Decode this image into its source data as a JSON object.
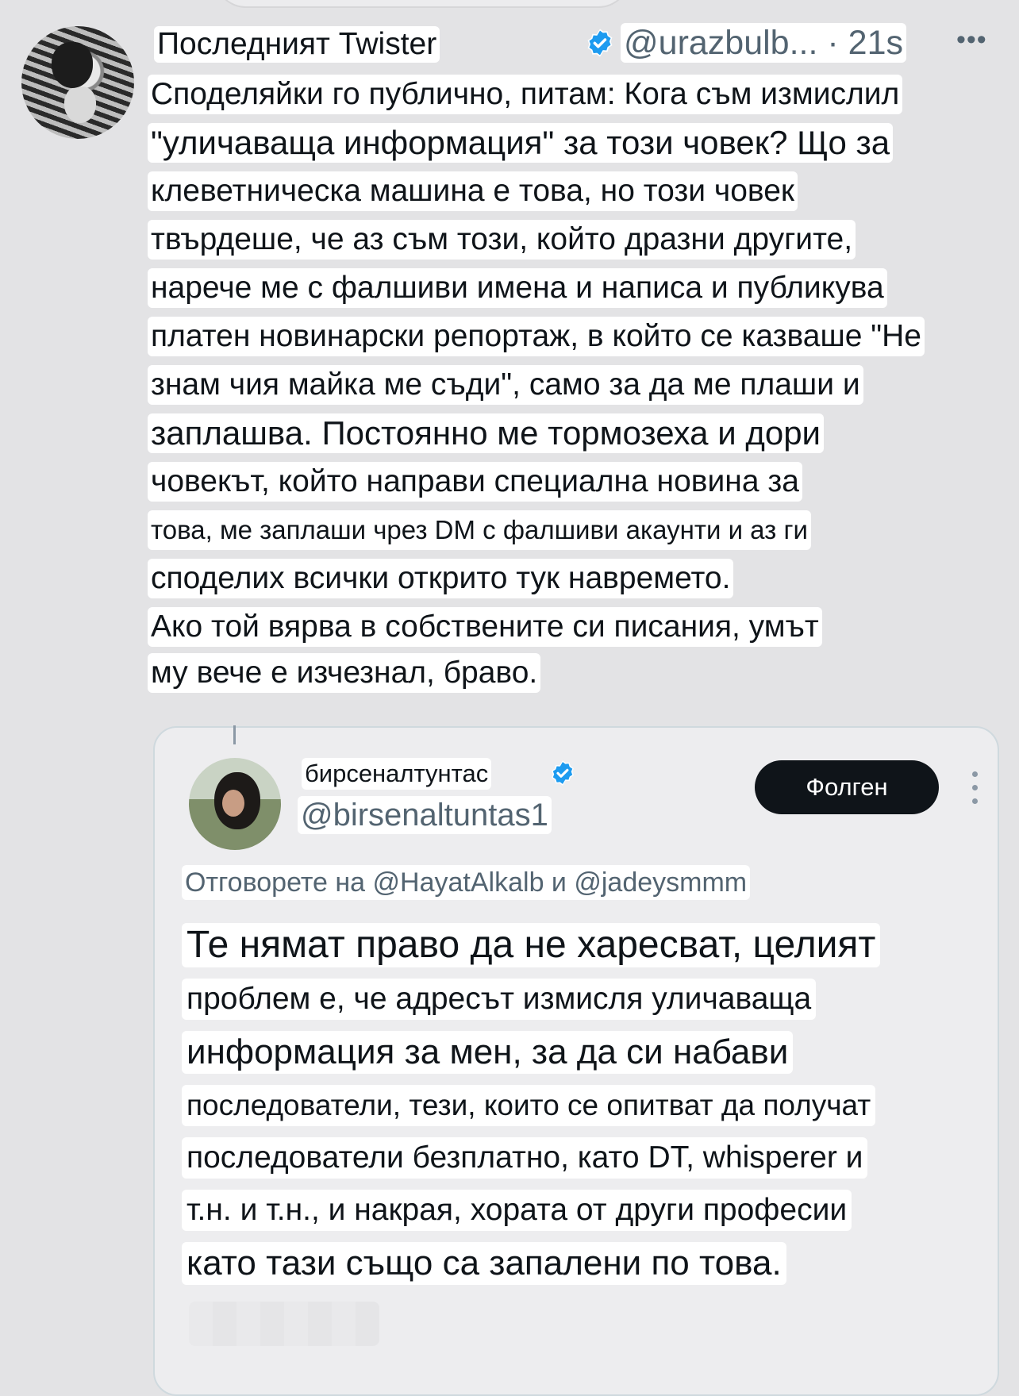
{
  "tweet": {
    "author_name": "Последният Twister",
    "handle_time": "@urazbulb... · 21s",
    "more_icon": "more-horizontal-icon",
    "lines": [
      "Споделяйки го публично, питам: Кога съм измислил",
      "\"уличаваща информация\" за този човек? Що за",
      "клеветническа машина е това, но този човек",
      "твърдеше, че аз съм този, който дразни другите,",
      "нарече ме с фалшиви имена и написа и публикува",
      "платен новинарски репортаж, в който се казваше \"Не",
      "знам чия майка ме съди\", само за да ме плаши и",
      "заплашва. Постоянно ме тормозеха и дори",
      "човекът, който направи специална новина за",
      "това, ме заплаши чрез DM с фалшиви акаунти и аз ги",
      "споделих всички открито тук навремето.",
      "Ако той вярва в собствените си писания, умът",
      "му вече е изчезнал, браво."
    ]
  },
  "quoted": {
    "name": "бирсеналтунтас",
    "handle": "@birsenaltuntas1",
    "follow_label": "Фолген",
    "reply_to": "Отговорете на @HayatAlkalb и @jadeysmmm",
    "lines": [
      "Те нямат право да не харесват, целият",
      "проблем е, че адресът измисля уличаваща",
      "информация за мен, за да си набави",
      "последователи, тези, които се опитват да получат",
      "последователи безплатно, като DT, whisperer и",
      "т.н. и т.н., и накрая, хората от други професии",
      "като тази също са запалени по това."
    ]
  },
  "colors": {
    "background": "#e3e3e5",
    "highlight": "#ffffff",
    "verified": "#1d9bf0",
    "secondary_text": "#536471",
    "follow_button": "#0f1419"
  }
}
